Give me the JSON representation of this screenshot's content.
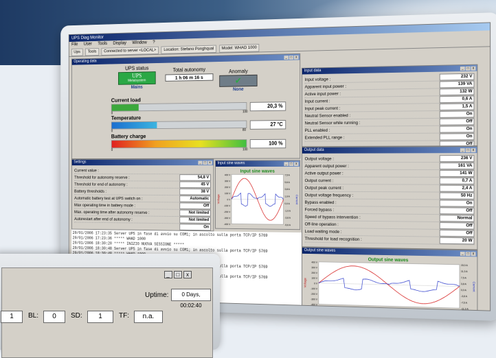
{
  "app": {
    "title": "UPS Diag Monitor",
    "menu": [
      "File",
      "User",
      "Tools",
      "Display",
      "Window",
      "?"
    ],
    "toolbar": [
      "Ups",
      "Tools",
      "Connected to server <LOCAL>",
      "Location: Stefano Ponghqual",
      "Model: WHAD 1000"
    ]
  },
  "operating": {
    "window_title": "Operating data",
    "ups_status_label": "UPS status",
    "ups_logo_line1": "UPS",
    "ups_logo_line2": "Metalsystem",
    "ups_status_value": "Mains",
    "autonomy_label": "Total autonomy",
    "autonomy_value": "1 h 06 m 16 s",
    "anomaly_label": "Anomaly",
    "anomaly_value": "None",
    "current_load_label": "Current load",
    "current_load_value": "20,3 %",
    "current_load_fraction": 0.203,
    "temperature_label": "Temperature",
    "temperature_value": "27 °C",
    "temperature_fraction": 0.34,
    "battery_label": "Battery charge",
    "battery_value": "100 %",
    "battery_fraction": 1.0,
    "scale_min": "0",
    "scale_max_load": "100",
    "scale_max_temp": "80",
    "scale_max_batt": "100"
  },
  "input_data": {
    "window_title": "Input data",
    "rows": [
      {
        "label": "Input voltage :",
        "value": "232 V"
      },
      {
        "label": "Apparent input power :",
        "value": "139 VA"
      },
      {
        "label": "Active input power :",
        "value": "132 W"
      },
      {
        "label": "Input current :",
        "value": "0,6 A"
      },
      {
        "label": "Input peak current :",
        "value": "1,5 A"
      },
      {
        "label": "Neutral Sensor enabled :",
        "value": "On"
      },
      {
        "label": "Neutral Sensor while running :",
        "value": "Off"
      },
      {
        "label": "PLL enabled :",
        "value": "On"
      },
      {
        "label": "Extended PLL range :",
        "value": "On"
      },
      {
        "label": "",
        "value": "Off"
      }
    ]
  },
  "output_data": {
    "window_title": "Output data",
    "rows": [
      {
        "label": "Output voltage :",
        "value": "236 V"
      },
      {
        "label": "Apparent output power :",
        "value": "161 VA"
      },
      {
        "label": "Active output power :",
        "value": "141 W"
      },
      {
        "label": "Output current :",
        "value": "0,7 A"
      },
      {
        "label": "Output peak current :",
        "value": "2,4 A"
      },
      {
        "label": "Output voltage frequency :",
        "value": "50 Hz"
      },
      {
        "label": "Bypass enabled :",
        "value": "On"
      },
      {
        "label": "Forced bypass :",
        "value": "Off"
      },
      {
        "label": "Speed of bypass intervention :",
        "value": "Normal"
      },
      {
        "label": "Off-line operation :",
        "value": "Off"
      },
      {
        "label": "Load waiting mode :",
        "value": "Off"
      },
      {
        "label": "Threshold for load recognition :",
        "value": "20 W"
      }
    ]
  },
  "settings": {
    "window_title": "Settings",
    "rows": [
      {
        "label": "Current value :",
        "value": ""
      },
      {
        "label": "Threshold for autonomy reserve :",
        "value": "54,8 V"
      },
      {
        "label": "Threshold for end of autonomy :",
        "value": "45 V"
      },
      {
        "label": "Battery thresholds :",
        "value": "38 V"
      },
      {
        "label": "Automatic battery test at UPS switch on :",
        "value": "Automatic"
      },
      {
        "label": "Max operating time in battery mode :",
        "value": "Off"
      },
      {
        "label": "Max. operating time after autonomy reserve :",
        "value": "Not limited"
      },
      {
        "label": "Autorestart after end of autonomy :",
        "value": "Not limited"
      },
      {
        "label": "",
        "value": "On"
      }
    ]
  },
  "input_wave": {
    "window_title": "Input sine waves",
    "title": "Input sine waves",
    "ylabel_left": "Voltage",
    "ylabel_right": "Current",
    "left_ticks": [
      "400 V",
      "300 V",
      "200 V",
      "100 V",
      "0 V",
      "-100 V",
      "-200 V",
      "-300 V",
      "-400 V"
    ],
    "right_ticks": [
      "7,5 A",
      "5,6 A",
      "3,8 A",
      "1,9 A",
      "0,0 A",
      "-1,9 A",
      "-3,8 A",
      "-5,6 A"
    ]
  },
  "output_wave": {
    "window_title": "Output sine waves",
    "title": "Output sine waves",
    "ylabel_left": "Voltage",
    "ylabel_right": "Current",
    "left_ticks": [
      "400 V",
      "300 V",
      "200 V",
      "100 V",
      "0 V",
      "-100 V",
      "-200 V",
      "-300 V",
      "-400 V"
    ],
    "right_ticks": [
      "15,0 A",
      "11,3 A",
      "7,5 A",
      "3,8 A",
      "0,0 A",
      "-3,8 A",
      "-7,5 A",
      "-11,3 A"
    ]
  },
  "log": {
    "lines": [
      "20/01/2006 17:23:35 Server UPS in fase di avvio su COM1; in ascolto sulla porta TCP/IP 5769",
      "20/01/2006 17:23:36 *****  WHAD 1000",
      "20/01/2006 18:30:20 ***** INIZIO NUOVA SESSIONE *****",
      "20/01/2006 18:30:48 Server UPS in fase di avvio su COM1; in ascolto sulla porta TCP/IP 5769",
      "20/01/2006 18:30:48 *****  WHAD 1000",
      "23/01/2006 09:23:00 ***** INIZIO NUOVA SESSIONE *****",
      "23/01/2006 09:23:01 Server UPS in fase di avvio su COM1; in ascolto sulla porta TCP/IP 5769",
      "23/01/2006 09:23:01 *****  WHAD 1000",
      "23/01/2006 09:23:02 Server UPS in fase di avvio su COM1; in ascolto sulla porta TCP/IP 5769"
    ]
  },
  "front": {
    "uptime_label": "Uptime:",
    "uptime_value": "0 Days, 00:02:40",
    "field1": "1",
    "bl_label": "BL:",
    "bl_value": "0",
    "sd_label": "SD:",
    "sd_value": "1",
    "tf_label": "TF:",
    "tf_value": "n.a."
  },
  "colors": {
    "accent": "#0a246a",
    "wave_voltage": "#d62020",
    "wave_current": "#2030c8",
    "anomaly_ok": "#2aa845"
  }
}
